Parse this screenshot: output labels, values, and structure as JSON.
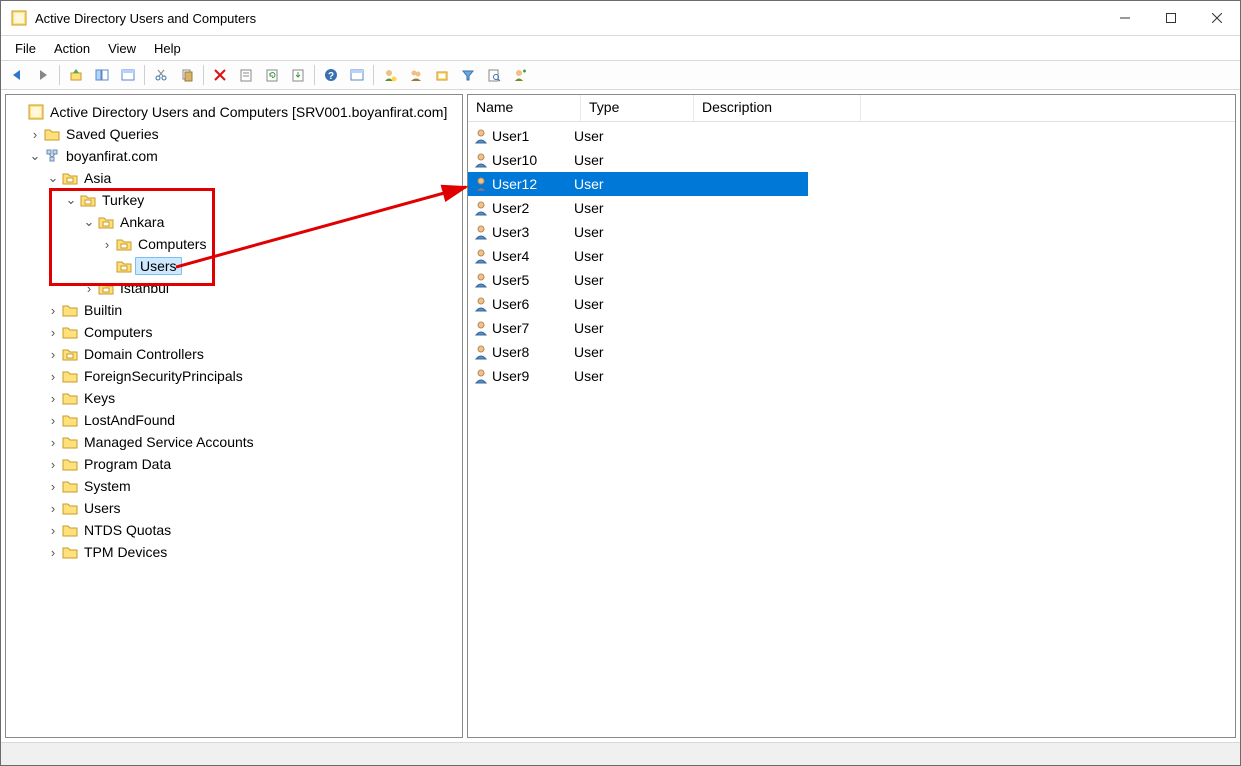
{
  "window": {
    "title": "Active Directory Users and Computers"
  },
  "menu": {
    "file": "File",
    "action": "Action",
    "view": "View",
    "help": "Help"
  },
  "tree": {
    "root": "Active Directory Users and Computers [SRV001.boyanfirat.com]",
    "saved_queries": "Saved Queries",
    "domain": "boyanfirat.com",
    "asia": "Asia",
    "turkey": "Turkey",
    "ankara": "Ankara",
    "ankara_computers": "Computers",
    "ankara_users": "Users",
    "istanbul": "Istanbul",
    "builtin": "Builtin",
    "computers": "Computers",
    "dc": "Domain Controllers",
    "fsp": "ForeignSecurityPrincipals",
    "keys": "Keys",
    "laf": "LostAndFound",
    "msa": "Managed Service Accounts",
    "pdata": "Program Data",
    "system": "System",
    "users": "Users",
    "ntds": "NTDS Quotas",
    "tpm": "TPM Devices"
  },
  "list": {
    "headers": {
      "name": "Name",
      "type": "Type",
      "description": "Description"
    },
    "type_user": "User",
    "rows": [
      {
        "name": "User1",
        "type": "User",
        "selected": false
      },
      {
        "name": "User10",
        "type": "User",
        "selected": false
      },
      {
        "name": "User12",
        "type": "User",
        "selected": true
      },
      {
        "name": "User2",
        "type": "User",
        "selected": false
      },
      {
        "name": "User3",
        "type": "User",
        "selected": false
      },
      {
        "name": "User4",
        "type": "User",
        "selected": false
      },
      {
        "name": "User5",
        "type": "User",
        "selected": false
      },
      {
        "name": "User6",
        "type": "User",
        "selected": false
      },
      {
        "name": "User7",
        "type": "User",
        "selected": false
      },
      {
        "name": "User8",
        "type": "User",
        "selected": false
      },
      {
        "name": "User9",
        "type": "User",
        "selected": false
      }
    ]
  },
  "annotation": {
    "highlight_box": true,
    "arrow_from_list_to_tree": true
  }
}
